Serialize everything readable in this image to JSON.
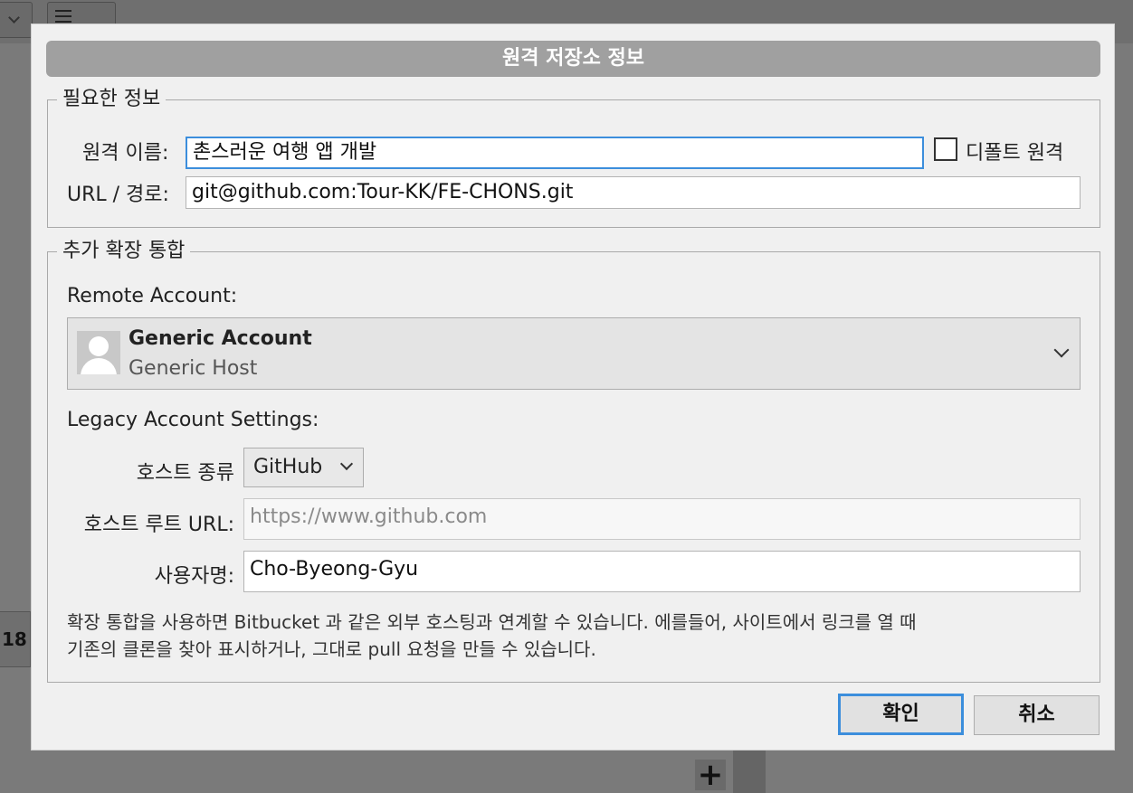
{
  "dialog": {
    "title": "원격 저장소 정보",
    "required": {
      "legend": "필요한 정보",
      "remote_name_label": "원격 이름:",
      "remote_name_value": "촌스러운 여행 앱 개발",
      "default_remote_label": "디폴트 원격",
      "default_remote_checked": false,
      "url_label": "URL / 경로:",
      "url_value": "git@github.com:Tour-KK/FE-CHONS.git"
    },
    "extended": {
      "legend": "추가 확장 통합",
      "remote_account_label": "Remote Account:",
      "account_name": "Generic Account",
      "account_host": "Generic Host",
      "legacy_label": "Legacy Account Settings:",
      "host_type_label": "호스트 종류",
      "host_type_value": "GitHub",
      "host_root_label": "호스트 루트 URL:",
      "host_root_placeholder": "https://www.github.com",
      "username_label": "사용자명:",
      "username_value": "Cho-Byeong-Gyu",
      "info_line1": "확장 통합을 사용하면 Bitbucket 과 같은 외부 호스팅과 연계할 수 있습니다. 에를들어, 사이트에서 링크를 열 때",
      "info_line2": "기존의 클론을 찾아 표시하거나, 그대로 pull 요청을 만들 수 있습니다."
    },
    "buttons": {
      "ok": "확인",
      "cancel": "취소"
    }
  },
  "background": {
    "left_strip_text": "18",
    "plus_text": "+"
  },
  "colors": {
    "accent": "#3c8edc",
    "titlebar": "#a0a0a0"
  }
}
